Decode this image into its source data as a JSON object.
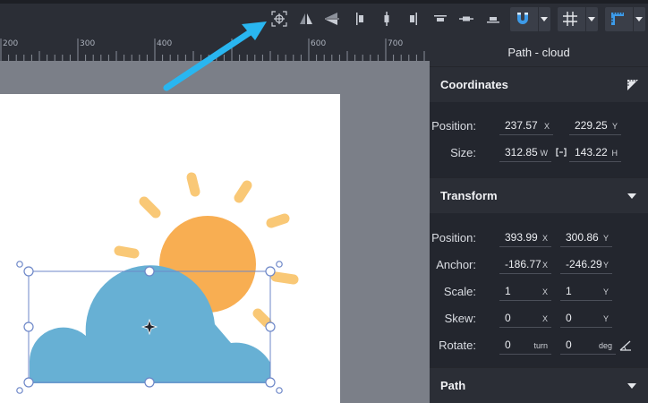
{
  "toolbar": {
    "icons": [
      "fit-selection-icon",
      "flip-horizontal-icon",
      "flip-vertical-icon",
      "align-left-icon",
      "align-center-icon",
      "align-right-icon",
      "align-top-icon",
      "align-middle-icon",
      "align-bottom-icon",
      "magnet-icon",
      "grid-icon",
      "ruler-guides-icon"
    ],
    "accent": "#3d9be9"
  },
  "ruler": {
    "labels": [
      "200",
      "300",
      "400",
      "600",
      "700"
    ]
  },
  "canvas": {
    "selection_color": "#6d87c8",
    "cloud_color": "#67b0d4",
    "sun_color": "#f8ae52",
    "rays_color": "#f9c876",
    "annotation_arrow_color": "#29b6f0"
  },
  "panel": {
    "title": "Path - cloud",
    "coordinates": {
      "heading": "Coordinates",
      "position_label": "Position:",
      "position_x": "237.57",
      "position_y": "229.25",
      "size_label": "Size:",
      "size_w": "312.85",
      "size_h": "143.22",
      "unit_x": "X",
      "unit_y": "Y",
      "unit_w": "W",
      "unit_h": "H"
    },
    "transform": {
      "heading": "Transform",
      "position_label": "Position:",
      "position_x": "393.99",
      "position_y": "300.86",
      "anchor_label": "Anchor:",
      "anchor_x": "-186.77",
      "anchor_y": "-246.29",
      "scale_label": "Scale:",
      "scale_x": "1",
      "scale_y": "1",
      "skew_label": "Skew:",
      "skew_x": "0",
      "skew_y": "0",
      "rotate_label": "Rotate:",
      "rotate_turn": "0",
      "rotate_deg": "0",
      "unit_x": "X",
      "unit_y": "Y",
      "unit_turn": "turn",
      "unit_deg": "deg"
    },
    "path": {
      "heading": "Path"
    }
  }
}
